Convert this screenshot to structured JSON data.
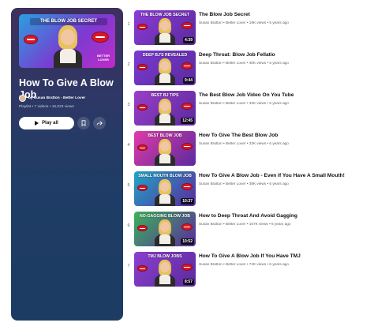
{
  "playlist": {
    "thumbnail_caption": "THE BLOW JOB SECRET",
    "thumbnail_badge": "BETTER LOVER",
    "title": "How To Give A Blow Job",
    "owner": "by Susan Bratton - Better Lover",
    "meta": "Playlist • 7 videos • 16,023 views",
    "play_all_label": "Play all",
    "icons": {
      "save": "bookmark-icon",
      "share": "share-icon"
    }
  },
  "videos": [
    {
      "index": "1",
      "title": "The Blow Job Secret",
      "channel": "Susan Bratton • Better Lover",
      "views": "19K views",
      "age": "5 years ago",
      "duration": "4:39",
      "thumb_caption": "THE BLOW JOB SECRET",
      "bg": "#8b3bd6"
    },
    {
      "index": "2",
      "title": "Deep Throat: Blow Job Fellatio",
      "channel": "Susan Bratton • Better Lover",
      "views": "40K views",
      "age": "5 years ago",
      "duration": "9:44",
      "thumb_caption": "DEEP BJ'S REVEALED",
      "bg": "#7a3bd1"
    },
    {
      "index": "3",
      "title": "The Best Blow Job Video On You Tube",
      "channel": "Susan Bratton • Better Lover",
      "views": "32K views",
      "age": "5 years ago",
      "duration": "12:45",
      "thumb_caption": "BEST BJ TIPS",
      "bg": "#9b3ec9"
    },
    {
      "index": "4",
      "title": "How To Give The Best Blow Job",
      "channel": "Susan Bratton • Better Lover",
      "views": "33K views",
      "age": "6 years ago",
      "duration": "",
      "thumb_caption": "BEST BLOW JOB",
      "bg": "#e23aa8"
    },
    {
      "index": "5",
      "title": "How To Give A Blow Job - Even If You Have A Small Mouth!",
      "channel": "Susan Bratton • Better Lover",
      "views": "38K views",
      "age": "6 years ago",
      "duration": "10:37",
      "thumb_caption": "SMALL MOUTH BLOW JOB",
      "bg": "#1fa6c8"
    },
    {
      "index": "6",
      "title": "How to Deep Throat And Avoid Gagging",
      "channel": "Susan Bratton • Better Lover",
      "views": "167K views",
      "age": "6 years ago",
      "duration": "10:52",
      "thumb_caption": "NO-GAGGING BLOW JOB",
      "bg": "#3bb35a"
    },
    {
      "index": "7",
      "title": "How To Give A Blow Job If You Have TMJ",
      "channel": "Susan Bratton • Better Lover",
      "views": "74K views",
      "age": "6 years ago",
      "duration": "8:57",
      "thumb_caption": "TMJ BLOW JOBS",
      "bg": "#8c3fcf"
    }
  ],
  "colors": {
    "panel_top": "#3e2f5c",
    "panel_bottom": "#1c3c63",
    "accent_lips": "#d8182a"
  }
}
